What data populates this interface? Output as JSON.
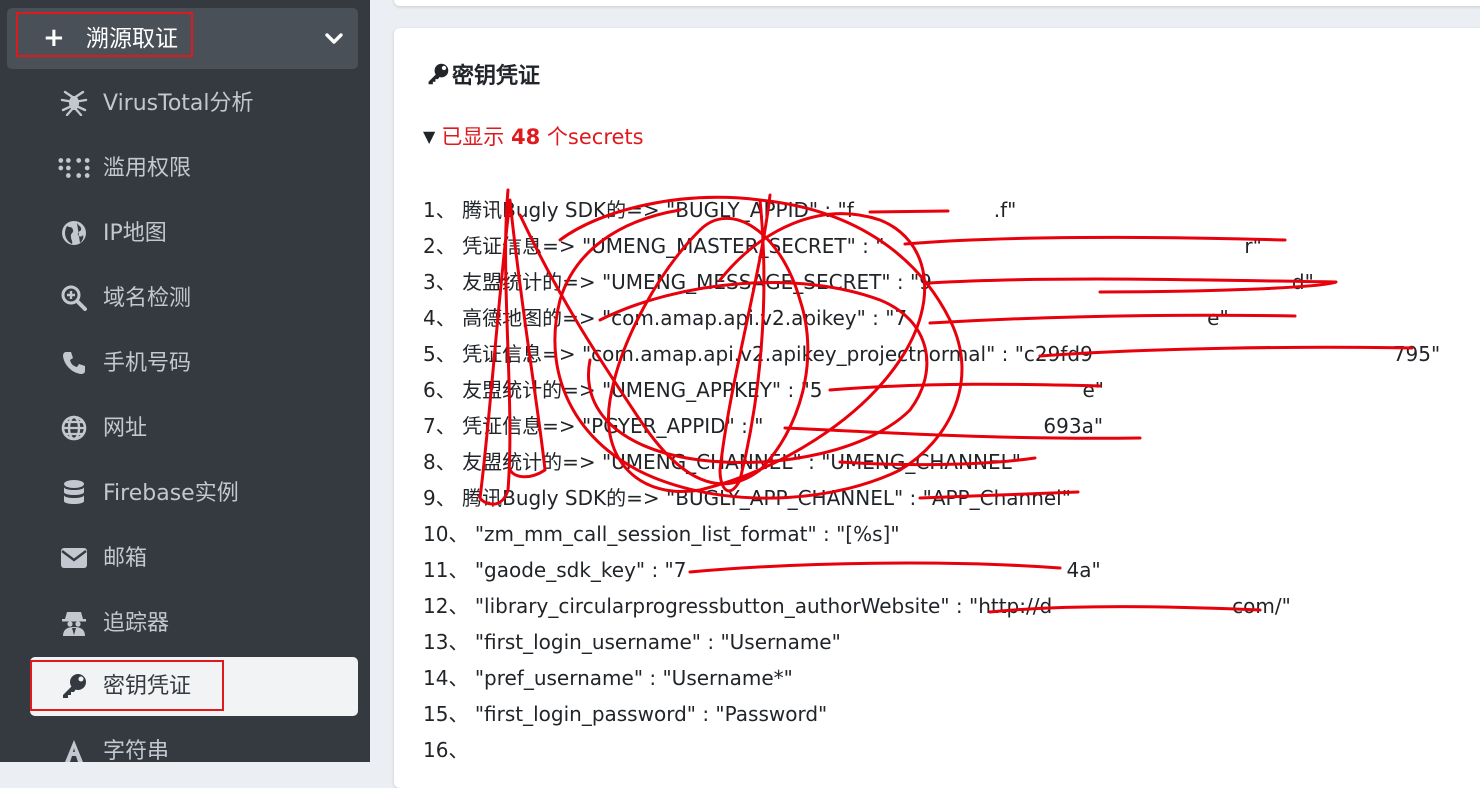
{
  "sidebar": {
    "header": {
      "label": "溯源取证"
    },
    "items": [
      {
        "label": "VirusTotal分析",
        "icon": "spider-icon"
      },
      {
        "label": "滥用权限",
        "icon": "braille-icon"
      },
      {
        "label": "IP地图",
        "icon": "globe-americas-icon"
      },
      {
        "label": "域名检测",
        "icon": "search-plus-icon"
      },
      {
        "label": "手机号码",
        "icon": "phone-icon"
      },
      {
        "label": "网址",
        "icon": "globe-icon"
      },
      {
        "label": "Firebase实例",
        "icon": "database-icon"
      },
      {
        "label": "邮箱",
        "icon": "envelope-icon"
      },
      {
        "label": "追踪器",
        "icon": "user-secret-icon"
      },
      {
        "label": "密钥凭证",
        "icon": "key-icon",
        "active": true
      },
      {
        "label": "字符串",
        "icon": "font-icon"
      }
    ]
  },
  "main": {
    "title": "密钥凭证",
    "summary": {
      "prefix": "已显示 ",
      "count": "48",
      "suffix": " 个secrets"
    },
    "secrets": [
      {
        "num": "1、",
        "text": "腾讯Bugly SDK的=> \"BUGLY_APPID\" : \"f       .f\""
      },
      {
        "num": "2、",
        "text": "凭证信息=> \"UMENG_MASTER_SECRET\" : \"                  r\""
      },
      {
        "num": "3、",
        "text": "友盟统计的=> \"UMENG_MESSAGE_SECRET\" : \"9                  d\""
      },
      {
        "num": "4、",
        "text": "高德地图的=> \"com.amap.api.v2.apikey\" : \"7               e\""
      },
      {
        "num": "5、",
        "text": "凭证信息=> \"com.amap.api.v2.apikey_projectnormal\" : \"c29fd9               795\""
      },
      {
        "num": "6、",
        "text": "友盟统计的=> \"UMENG_APPKEY\" : \"5             e\""
      },
      {
        "num": "7、",
        "text": "凭证信息=> \"PGYER_APPID\" : \"              693a\""
      },
      {
        "num": "8、",
        "text": "友盟统计的=> \"UMENG_CHANNEL\" : \"UMENG_CHANNEL\""
      },
      {
        "num": "9、",
        "text": "腾讯Bugly SDK的=> \"BUGLY_APP_CHANNEL\" : \"APP_Channel\""
      },
      {
        "num": "10、",
        "text": " \"zm_mm_call_session_list_format\" : \"[%s]\""
      },
      {
        "num": "11、",
        "text": " \"gaode_sdk_key\" : \"7                   4a\""
      },
      {
        "num": "12、",
        "text": " \"library_circularprogressbutton_authorWebsite\" : \"http://d         com/\""
      },
      {
        "num": "13、",
        "text": " \"first_login_username\" : \"Username\""
      },
      {
        "num": "14、",
        "text": " \"pref_username\" : \"Username*\""
      },
      {
        "num": "15、",
        "text": " \"first_login_password\" : \"Password\""
      },
      {
        "num": "16、",
        "text": ""
      }
    ]
  },
  "colors": {
    "sidebar_bg": "#343a40",
    "highlight_red": "#e0191d",
    "accent_red": "#e0191d"
  }
}
